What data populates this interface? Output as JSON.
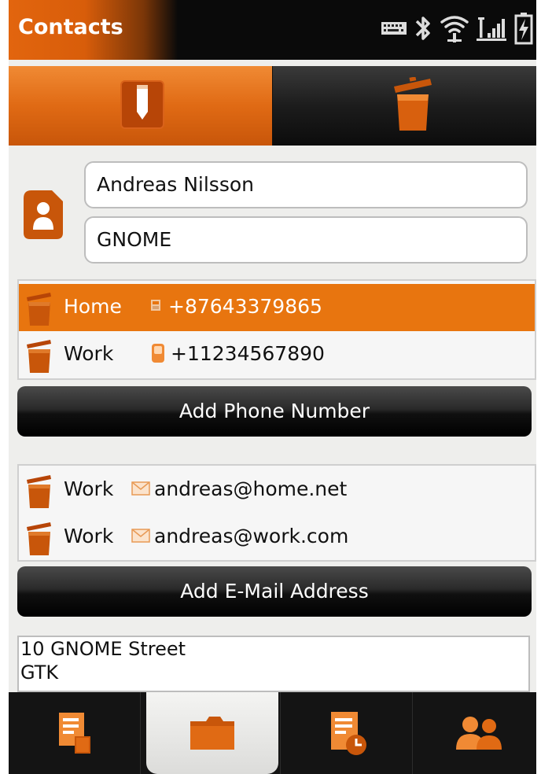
{
  "app": {
    "title": "Contacts"
  },
  "status_icons": [
    "keyboard-icon",
    "bluetooth-icon",
    "wifi-icon",
    "signal-icon",
    "battery-charging-icon"
  ],
  "toolbar": {
    "buttons": [
      "edit-icon",
      "trash-icon"
    ]
  },
  "contact": {
    "avatar_icon": "contact-card-icon",
    "name": "Andreas Nilsson",
    "organization": "GNOME"
  },
  "phones": [
    {
      "type": "Home",
      "icon": "landline-icon",
      "number": "+87643379865",
      "selected": true
    },
    {
      "type": "Work",
      "icon": "mobile-icon",
      "number": "+11234567890",
      "selected": false
    }
  ],
  "add_phone_label": "Add Phone Number",
  "emails": [
    {
      "type": "Work",
      "icon": "envelope-icon",
      "address": "andreas@home.net"
    },
    {
      "type": "Work",
      "icon": "envelope-icon",
      "address": "andreas@work.com"
    }
  ],
  "add_email_label": "Add E-Mail Address",
  "address": {
    "line1": "10 GNOME Street",
    "line2": "GTK"
  },
  "tabbar": {
    "tabs": [
      "notes-icon",
      "folder-icon",
      "calendar-list-icon",
      "people-icon"
    ],
    "active_index": 1
  },
  "colors": {
    "accent": "#e8750f",
    "dark": "#111111"
  }
}
